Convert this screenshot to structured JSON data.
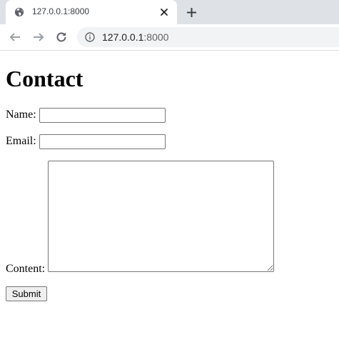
{
  "browser": {
    "tab": {
      "title": "127.0.0.1:8000",
      "favicon": "globe-icon",
      "close_icon": "close-icon"
    },
    "new_tab_icon": "plus-icon",
    "nav": {
      "back_icon": "arrow-left-icon",
      "forward_icon": "arrow-right-icon",
      "reload_icon": "reload-icon"
    },
    "omnibox": {
      "security_icon": "info-icon",
      "host": "127.0.0.1",
      "port": ":8000"
    }
  },
  "page": {
    "title": "Contact",
    "form": {
      "name_label": "Name:",
      "name_value": "",
      "email_label": "Email:",
      "email_value": "",
      "content_label": "Content:",
      "content_value": "",
      "submit_label": "Submit"
    }
  },
  "colors": {
    "tabstrip": "#dee1e6",
    "omnibox": "#f1f3f4",
    "icon": "#5f6368",
    "input_border": "#767676",
    "button_bg": "#efefef"
  }
}
